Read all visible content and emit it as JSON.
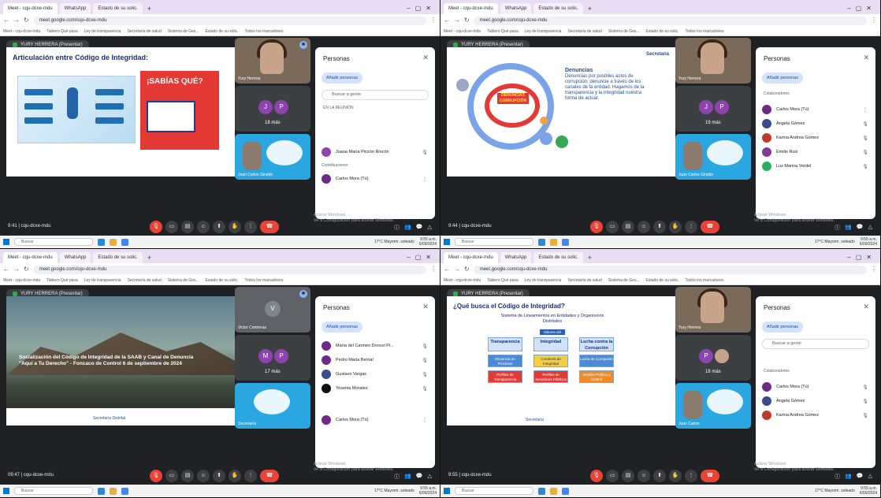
{
  "browser": {
    "tabs": [
      "Meet - cqu-dcxe-mdu",
      "WhatsApp",
      "Estado de su solic."
    ],
    "url": "meet.google.com/cqu-dcxe-mdu",
    "bookmarks": [
      "Meet - cqu-dcxe-mdu",
      "Tablero Qué pasa",
      "Ley de transparencia",
      "Secretaría de salud",
      "Sistema de Ges...",
      "Estado de su solic.",
      "Todos los marcadores"
    ]
  },
  "meet": {
    "title": "YURY HERRERA (Presentar)",
    "panel_title": "Personas",
    "add_people": "Añadir personas",
    "search_placeholder": "Buscar a gente",
    "end_label": "☎",
    "activate_windows": [
      "Activar Windows",
      "Ve a Configuración para activar Windows."
    ]
  },
  "quadrants": [
    {
      "clock": "9:41 | cqu-dcxe-mdu",
      "slide": {
        "title": "Articulación entre Código de Integridad:",
        "headline": "¡SABÍAS QUÉ?"
      },
      "tiles": [
        {
          "name": "Yury Herrera"
        },
        {
          "initials": [
            "J",
            "P"
          ],
          "more": "18 más"
        },
        {
          "name": "Juan Carlos Giraldo"
        }
      ],
      "people_section": "EN LA REUNIÓN",
      "people": [
        {
          "name": "Juana María Pinzón Rincón",
          "color": "#8e44ad"
        },
        {
          "name": "Carlos Mora (Tú)",
          "color": "#6d2a87"
        }
      ],
      "meeting_count": "Contribuciones"
    },
    {
      "clock": "9:44 | cqu-dcxe-mdu",
      "slide": {
        "title": "Denuncias",
        "body": "Denuncias por posibles actos de corrupción: denuncie a través de los canales de la entidad. Hagamos de la transparencia y la integridad nuestra forma de actuar.",
        "badge": "DENUNCIAS CORRUPCIÓN",
        "brand": "Secretaría"
      },
      "tiles": [
        {
          "name": "Yury Herrera"
        },
        {
          "initials": [
            "J",
            "P"
          ],
          "more": "19 más"
        },
        {
          "name": "Juan Carlos Giraldo"
        }
      ],
      "people_section": "Colaboradores",
      "people": [
        {
          "name": "Carlos Mora (Tú)",
          "color": "#6d2a87"
        },
        {
          "name": "Angela Gómez",
          "color": "#3c4a8f"
        },
        {
          "name": "Karina Andrea Gómez",
          "color": "#c0392b"
        },
        {
          "name": "Emilio Ruiz",
          "color": "#7d3c98"
        },
        {
          "name": "Luz Marina Verdel",
          "color": "#27ae60"
        }
      ]
    },
    {
      "clock": "09:47 | cqu-dcxe-mdu",
      "slide": {
        "caption": "Socialización del Código de Integridad de la SAAB y Canal de Denuncia \"Aquí a Tu Derecho\" - Foncaco de Control 6 de septiembre de 2024",
        "footer": "Secretaría Distrital"
      },
      "tiles": [
        {
          "initials": [
            "V"
          ],
          "name": "Victor Contreras"
        },
        {
          "initials": [
            "M",
            "P"
          ],
          "more": "17 más"
        },
        {
          "name": "Secretaría"
        }
      ],
      "people_section": "",
      "people": [
        {
          "name": "María del Carmen Doncel Pi...",
          "color": "#6d2a87"
        },
        {
          "name": "Pedro María Bernal",
          "color": "#6d2a87"
        },
        {
          "name": "Gustavo Vargas",
          "color": "#3c4a8f"
        },
        {
          "name": "Yesenia Morales",
          "color": "#111"
        },
        {
          "name": "Carlos Mora (Tú)",
          "color": "#6d2a87"
        }
      ]
    },
    {
      "clock": "9:55 | cqu-dcxe-mdu",
      "slide": {
        "title": "¿Qué busca el Código de Integridad?",
        "subtitle": "Sistema de Lineamientos en Entidades y Organismos Distritales",
        "mid": "Valores del Servicio",
        "columns": [
          {
            "head": "Transparencia",
            "c1": "Eficiencia en Procesos",
            "c2": "Perfiles de Transparencia"
          },
          {
            "head": "Integridad",
            "c1": "Conducta de Integridad",
            "c2": "Perfiles de Servidores Públicos"
          },
          {
            "head": "Lucha contra la Corrupción",
            "c1": "Lucha de Corrupción",
            "c2": "Gestión Pública y Control"
          }
        ],
        "footer": "Secretaría"
      },
      "tiles": [
        {
          "name": "Yury Herrera"
        },
        {
          "initials": [
            "P"
          ],
          "more": "18 más"
        },
        {
          "name": "Juan Carlos"
        }
      ],
      "people_section": "Colaboradores",
      "people": [
        {
          "name": "Carlos Mora (Tú)",
          "color": "#6d2a87"
        },
        {
          "name": "Angela Gómez",
          "color": "#3c4a8f"
        },
        {
          "name": "Karina Andrea Gómez",
          "color": "#c0392b"
        }
      ]
    }
  ],
  "taskbar": {
    "search": "Buscar",
    "weather": "17°C Mayorm. soleado",
    "time": "9:55 a.m.",
    "date": "6/09/2024"
  },
  "colors": {
    "accent": "#8ab4f8",
    "end_call": "#ea4335",
    "tab_bar": "#e9ddf3"
  }
}
